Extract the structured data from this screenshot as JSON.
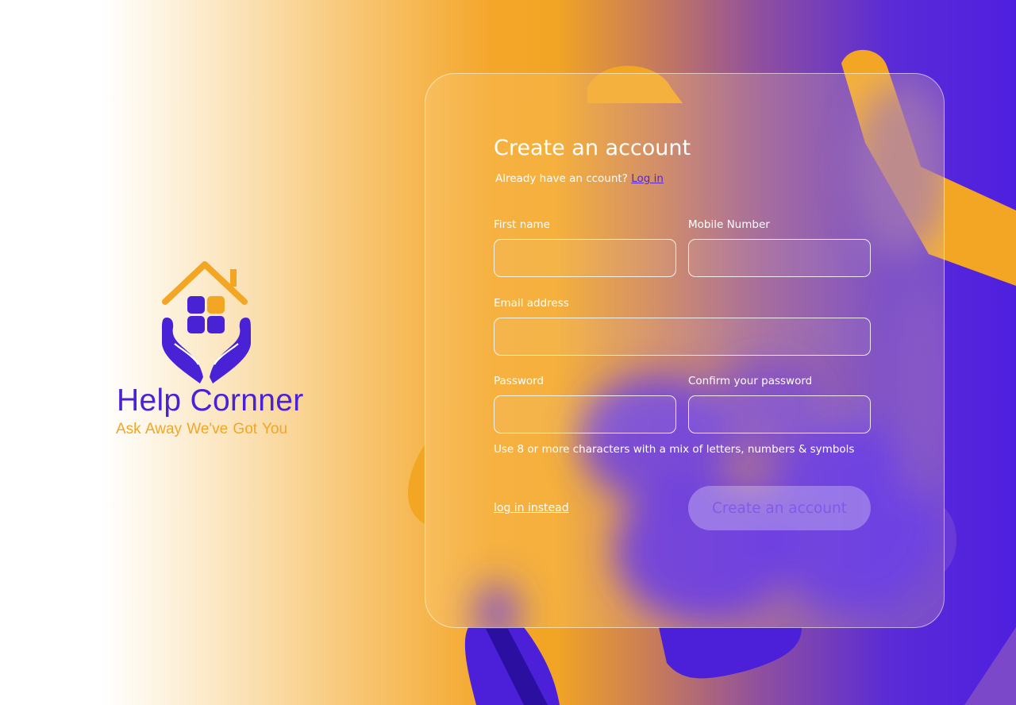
{
  "brand": {
    "name": "Help Cornner",
    "tagline": "Ask Away  We've Got You"
  },
  "form": {
    "title": "Create an account",
    "subtitle_prefix": "Already have an ccount?",
    "subtitle_link": "Log in",
    "fields": {
      "first_name": {
        "label": "First name",
        "value": "",
        "placeholder": ""
      },
      "mobile": {
        "label": "Mobile Number",
        "value": "",
        "placeholder": ""
      },
      "email": {
        "label": "Email address",
        "value": "",
        "placeholder": ""
      },
      "password": {
        "label": "Password",
        "value": "",
        "placeholder": ""
      },
      "confirm_password": {
        "label": "Confirm your password",
        "value": "",
        "placeholder": ""
      }
    },
    "password_hint": "Use 8 or more characters with a mix of letters, numbers & symbols",
    "login_instead": "log in instead",
    "submit_label": "Create an account"
  },
  "colors": {
    "brand_purple": "#4a22d6",
    "brand_orange": "#f3a623",
    "link_purple": "#5526d8"
  }
}
